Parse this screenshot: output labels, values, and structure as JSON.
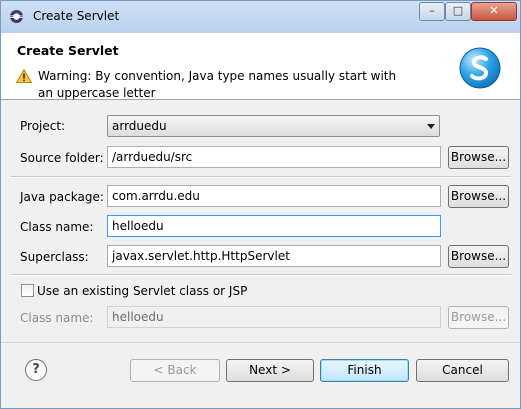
{
  "window": {
    "title": "Create Servlet",
    "controls": {
      "minimize": "–",
      "maximize": "□",
      "close": "✕"
    }
  },
  "banner": {
    "title": "Create Servlet",
    "warning": "Warning: By convention, Java type names usually start with an uppercase letter"
  },
  "form": {
    "project": {
      "label": "Project:",
      "value": "arrduedu"
    },
    "source_folder": {
      "label": "Source folder:",
      "value": "/arrduedu/src",
      "button": "Browse..."
    },
    "java_package": {
      "label": "Java package:",
      "value": "com.arrdu.edu",
      "button": "Browse..."
    },
    "class_name": {
      "label": "Class name:",
      "value": "helloedu"
    },
    "superclass": {
      "label": "Superclass:",
      "value": "javax.servlet.http.HttpServlet",
      "button": "Browse..."
    },
    "use_existing": {
      "label": "Use an existing Servlet class or JSP",
      "checked": false
    },
    "existing_class_name": {
      "label": "Class name:",
      "value": "helloedu",
      "button": "Browse..."
    }
  },
  "footer": {
    "help": "?",
    "back": "< Back",
    "next": "Next >",
    "finish": "Finish",
    "cancel": "Cancel"
  },
  "colors": {
    "focus_border": "#3399ff",
    "title_bar": "#c4d8f1",
    "logo_blue": "#1b8fd6"
  }
}
